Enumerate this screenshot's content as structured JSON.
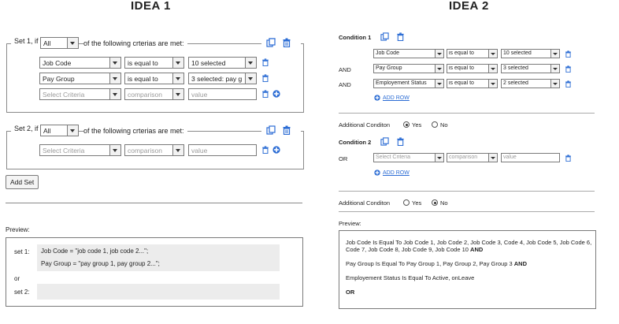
{
  "idea1": {
    "title": "IDEA 1",
    "set1": {
      "prefix": "Set 1, if",
      "quantifier": "All",
      "suffix": "of the following crterias are met:",
      "rows": [
        {
          "criteria": "Job Code",
          "comparison": "is equal to",
          "value": "10 selected"
        },
        {
          "criteria": "Pay Group",
          "comparison": "is equal to",
          "value": "3 selected: pay g"
        },
        {
          "criteria": "Select Criteria",
          "comparison": "comparison",
          "value": "value"
        }
      ]
    },
    "set2": {
      "prefix": "Set 2, if",
      "quantifier": "All",
      "suffix": "of the following crterias are met:",
      "rows": [
        {
          "criteria": "Select Criteria",
          "comparison": "comparison",
          "value": "value"
        }
      ]
    },
    "add_set_label": "Add Set",
    "preview_label": "Preview:",
    "preview": {
      "set1_label": "set 1:",
      "set1_line1": "Job Code = \"job code 1, job code 2...\";",
      "set1_line2": "Pay Group = \"pay group 1, pay group 2...\";",
      "or_label": "or",
      "set2_label": "set 2:"
    }
  },
  "idea2": {
    "title": "IDEA 2",
    "condition1": {
      "label": "Condition 1",
      "rows": [
        {
          "conj": "",
          "criteria": "Job Code",
          "comparison": "is equal to",
          "value": "10 selected"
        },
        {
          "conj": "AND",
          "criteria": "Pay Group",
          "comparison": "is equal to",
          "value": "3 selected"
        },
        {
          "conj": "AND",
          "criteria": "Employement Status",
          "comparison": "is equal to",
          "value": "2 selected"
        }
      ],
      "add_row": "ADD ROW"
    },
    "additional1": {
      "label": "Additional Conditon",
      "yes": "Yes",
      "no": "No",
      "selected": "Yes"
    },
    "condition2": {
      "label": "Condition 2",
      "conj": "OR",
      "criteria": "Select Criteria",
      "comparison": "comparison",
      "value": "value",
      "add_row": "ADD ROW"
    },
    "additional2": {
      "label": "Additional Conditon",
      "yes": "Yes",
      "no": "No",
      "selected": "No"
    },
    "preview_label": "Preview:",
    "preview": {
      "line1": "Job Code Is Equal To Job Code 1, Job Code 2, Job Code 3, Code 4, Job Code 5, Job Code 6, Code 7, Job Code 8, Job Code 9, Job Code 10",
      "line1_bold": "AND",
      "line2": "Pay Group Is Equal To Pay Group 1, Pay Group 2, Pay Group 3",
      "line2_bold": "AND",
      "line3": "Employement Status Is Equal To Active, onLeave",
      "or_label": "OR"
    }
  },
  "colors": {
    "accent": "#2b6cd4",
    "border": "#7a7a7a"
  }
}
